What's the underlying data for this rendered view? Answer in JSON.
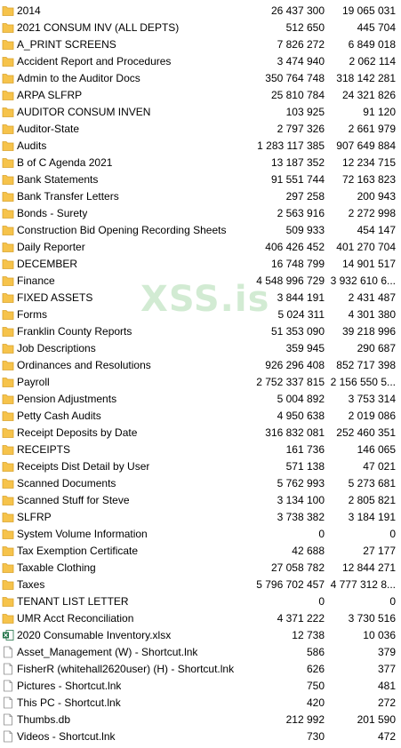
{
  "watermark": "XSS.is",
  "colors": {
    "folder": "#f6c34b",
    "excel": "#1e7145",
    "file": "#ffffff"
  },
  "rows": [
    {
      "name": "2014",
      "size": "26 437 300",
      "compressed": "19 065 031",
      "icon": "folder-icon"
    },
    {
      "name": "2021 CONSUM INV (ALL DEPTS)",
      "size": "512 650",
      "compressed": "445 704",
      "icon": "folder-icon"
    },
    {
      "name": "A_PRINT SCREENS",
      "size": "7 826 272",
      "compressed": "6 849 018",
      "icon": "folder-icon"
    },
    {
      "name": "Accident Report and Procedures",
      "size": "3 474 940",
      "compressed": "2 062 114",
      "icon": "folder-icon"
    },
    {
      "name": "Admin to the Auditor Docs",
      "size": "350 764 748",
      "compressed": "318 142 281",
      "icon": "folder-icon"
    },
    {
      "name": "ARPA SLFRP",
      "size": "25 810 784",
      "compressed": "24 321 826",
      "icon": "folder-icon"
    },
    {
      "name": "AUDITOR CONSUM INVEN",
      "size": "103 925",
      "compressed": "91 120",
      "icon": "folder-icon"
    },
    {
      "name": "Auditor-State",
      "size": "2 797 326",
      "compressed": "2 661 979",
      "icon": "folder-icon"
    },
    {
      "name": "Audits",
      "size": "1 283 117 385",
      "compressed": "907 649 884",
      "icon": "folder-icon"
    },
    {
      "name": "B of C Agenda 2021",
      "size": "13 187 352",
      "compressed": "12 234 715",
      "icon": "folder-icon"
    },
    {
      "name": "Bank Statements",
      "size": "91 551 744",
      "compressed": "72 163 823",
      "icon": "folder-icon"
    },
    {
      "name": "Bank Transfer Letters",
      "size": "297 258",
      "compressed": "200 943",
      "icon": "folder-icon"
    },
    {
      "name": "Bonds - Surety",
      "size": "2 563 916",
      "compressed": "2 272 998",
      "icon": "folder-icon"
    },
    {
      "name": "Construction Bid Opening Recording Sheets",
      "size": "509 933",
      "compressed": "454 147",
      "icon": "folder-icon"
    },
    {
      "name": "Daily Reporter",
      "size": "406 426 452",
      "compressed": "401 270 704",
      "icon": "folder-icon"
    },
    {
      "name": "DECEMBER",
      "size": "16 748 799",
      "compressed": "14 901 517",
      "icon": "folder-icon"
    },
    {
      "name": "Finance",
      "size": "4 548 996 729",
      "compressed": "3 932 610 6...",
      "icon": "folder-icon"
    },
    {
      "name": "FIXED ASSETS",
      "size": "3 844 191",
      "compressed": "2 431 487",
      "icon": "folder-icon"
    },
    {
      "name": "Forms",
      "size": "5 024 311",
      "compressed": "4 301 380",
      "icon": "folder-icon"
    },
    {
      "name": "Franklin County Reports",
      "size": "51 353 090",
      "compressed": "39 218 996",
      "icon": "folder-icon"
    },
    {
      "name": "Job Descriptions",
      "size": "359 945",
      "compressed": "290 687",
      "icon": "folder-icon"
    },
    {
      "name": "Ordinances and Resolutions",
      "size": "926 296 408",
      "compressed": "852 717 398",
      "icon": "folder-icon"
    },
    {
      "name": "Payroll",
      "size": "2 752 337 815",
      "compressed": "2 156 550 5...",
      "icon": "folder-icon"
    },
    {
      "name": "Pension Adjustments",
      "size": "5 004 892",
      "compressed": "3 753 314",
      "icon": "folder-icon"
    },
    {
      "name": "Petty Cash Audits",
      "size": "4 950 638",
      "compressed": "2 019 086",
      "icon": "folder-icon"
    },
    {
      "name": "Receipt Deposits by Date",
      "size": "316 832 081",
      "compressed": "252 460 351",
      "icon": "folder-icon"
    },
    {
      "name": "RECEIPTS",
      "size": "161 736",
      "compressed": "146 065",
      "icon": "folder-icon"
    },
    {
      "name": "Receipts Dist Detail by User",
      "size": "571 138",
      "compressed": "47 021",
      "icon": "folder-icon"
    },
    {
      "name": "Scanned Documents",
      "size": "5 762 993",
      "compressed": "5 273 681",
      "icon": "folder-icon"
    },
    {
      "name": "Scanned Stuff for Steve",
      "size": "3 134 100",
      "compressed": "2 805 821",
      "icon": "folder-icon"
    },
    {
      "name": "SLFRP",
      "size": "3 738 382",
      "compressed": "3 184 191",
      "icon": "folder-icon"
    },
    {
      "name": "System Volume Information",
      "size": "0",
      "compressed": "0",
      "icon": "folder-icon"
    },
    {
      "name": "Tax Exemption Certificate",
      "size": "42 688",
      "compressed": "27 177",
      "icon": "folder-icon"
    },
    {
      "name": "Taxable Clothing",
      "size": "27 058 782",
      "compressed": "12 844 271",
      "icon": "folder-icon"
    },
    {
      "name": "Taxes",
      "size": "5 796 702 457",
      "compressed": "4 777 312 8...",
      "icon": "folder-icon"
    },
    {
      "name": "TENANT LIST LETTER",
      "size": "0",
      "compressed": "0",
      "icon": "folder-icon"
    },
    {
      "name": "UMR Acct Reconciliation",
      "size": "4 371 222",
      "compressed": "3 730 516",
      "icon": "folder-icon"
    },
    {
      "name": "2020 Consumable Inventory.xlsx",
      "size": "12 738",
      "compressed": "10 036",
      "icon": "excel-file-icon"
    },
    {
      "name": "Asset_Management (W) - Shortcut.lnk",
      "size": "586",
      "compressed": "379",
      "icon": "file-icon"
    },
    {
      "name": "FisherR (whitehall2620user) (H) - Shortcut.lnk",
      "size": "626",
      "compressed": "377",
      "icon": "file-icon"
    },
    {
      "name": "Pictures - Shortcut.lnk",
      "size": "750",
      "compressed": "481",
      "icon": "file-icon"
    },
    {
      "name": "This PC - Shortcut.lnk",
      "size": "420",
      "compressed": "272",
      "icon": "file-icon"
    },
    {
      "name": "Thumbs.db",
      "size": "212 992",
      "compressed": "201 590",
      "icon": "file-icon"
    },
    {
      "name": "Videos - Shortcut.lnk",
      "size": "730",
      "compressed": "472",
      "icon": "file-icon"
    }
  ]
}
